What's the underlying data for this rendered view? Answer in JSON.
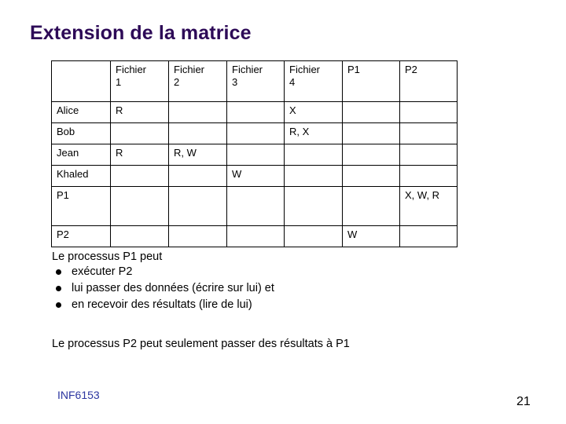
{
  "slide": {
    "title": "Extension de la matrice",
    "course_code": "INF6153",
    "page_number": "21",
    "title_color": "#2d0a57",
    "course_code_color": "#2b35a0"
  },
  "matrix": {
    "columns": [
      "",
      "Fichier 1",
      "Fichier 2",
      "Fichier 3",
      "Fichier 4",
      "P1",
      "P2"
    ],
    "column_labels": {
      "corner": "",
      "f1_line1": "Fichier",
      "f1_line2": "1",
      "f2_line1": "Fichier",
      "f2_line2": "2",
      "f3_line1": "Fichier",
      "f3_line2": "3",
      "f4_line1": "Fichier",
      "f4_line2": "4",
      "p1": "P1",
      "p2": "P2"
    },
    "rows": [
      {
        "name": "Alice",
        "f1": "R",
        "f2": "",
        "f3": "",
        "f4": "X",
        "p1": "",
        "p2": ""
      },
      {
        "name": "Bob",
        "f1": "",
        "f2": "",
        "f3": "",
        "f4": "R, X",
        "p1": "",
        "p2": ""
      },
      {
        "name": "Jean",
        "f1": "R",
        "f2": "R, W",
        "f3": "",
        "f4": "",
        "p1": "",
        "p2": ""
      },
      {
        "name": "Khaled",
        "f1": "",
        "f2": "",
        "f3": "W",
        "f4": "",
        "p1": "",
        "p2": ""
      },
      {
        "name": "P1",
        "f1": "",
        "f2": "",
        "f3": "",
        "f4": "",
        "p1": "",
        "p2": "X, W, R"
      },
      {
        "name": "P2",
        "f1": "",
        "f2": "",
        "f3": "",
        "f4": "",
        "p1": "W",
        "p2": ""
      }
    ]
  },
  "notes": {
    "lead": "Le processus P1 peut",
    "bullets": [
      "exécuter P2",
      "lui passer des données (écrire sur lui) et",
      "en recevoir des résultats (lire de lui)"
    ],
    "tail": "Le processus P2 peut seulement passer des résultats à P1"
  }
}
